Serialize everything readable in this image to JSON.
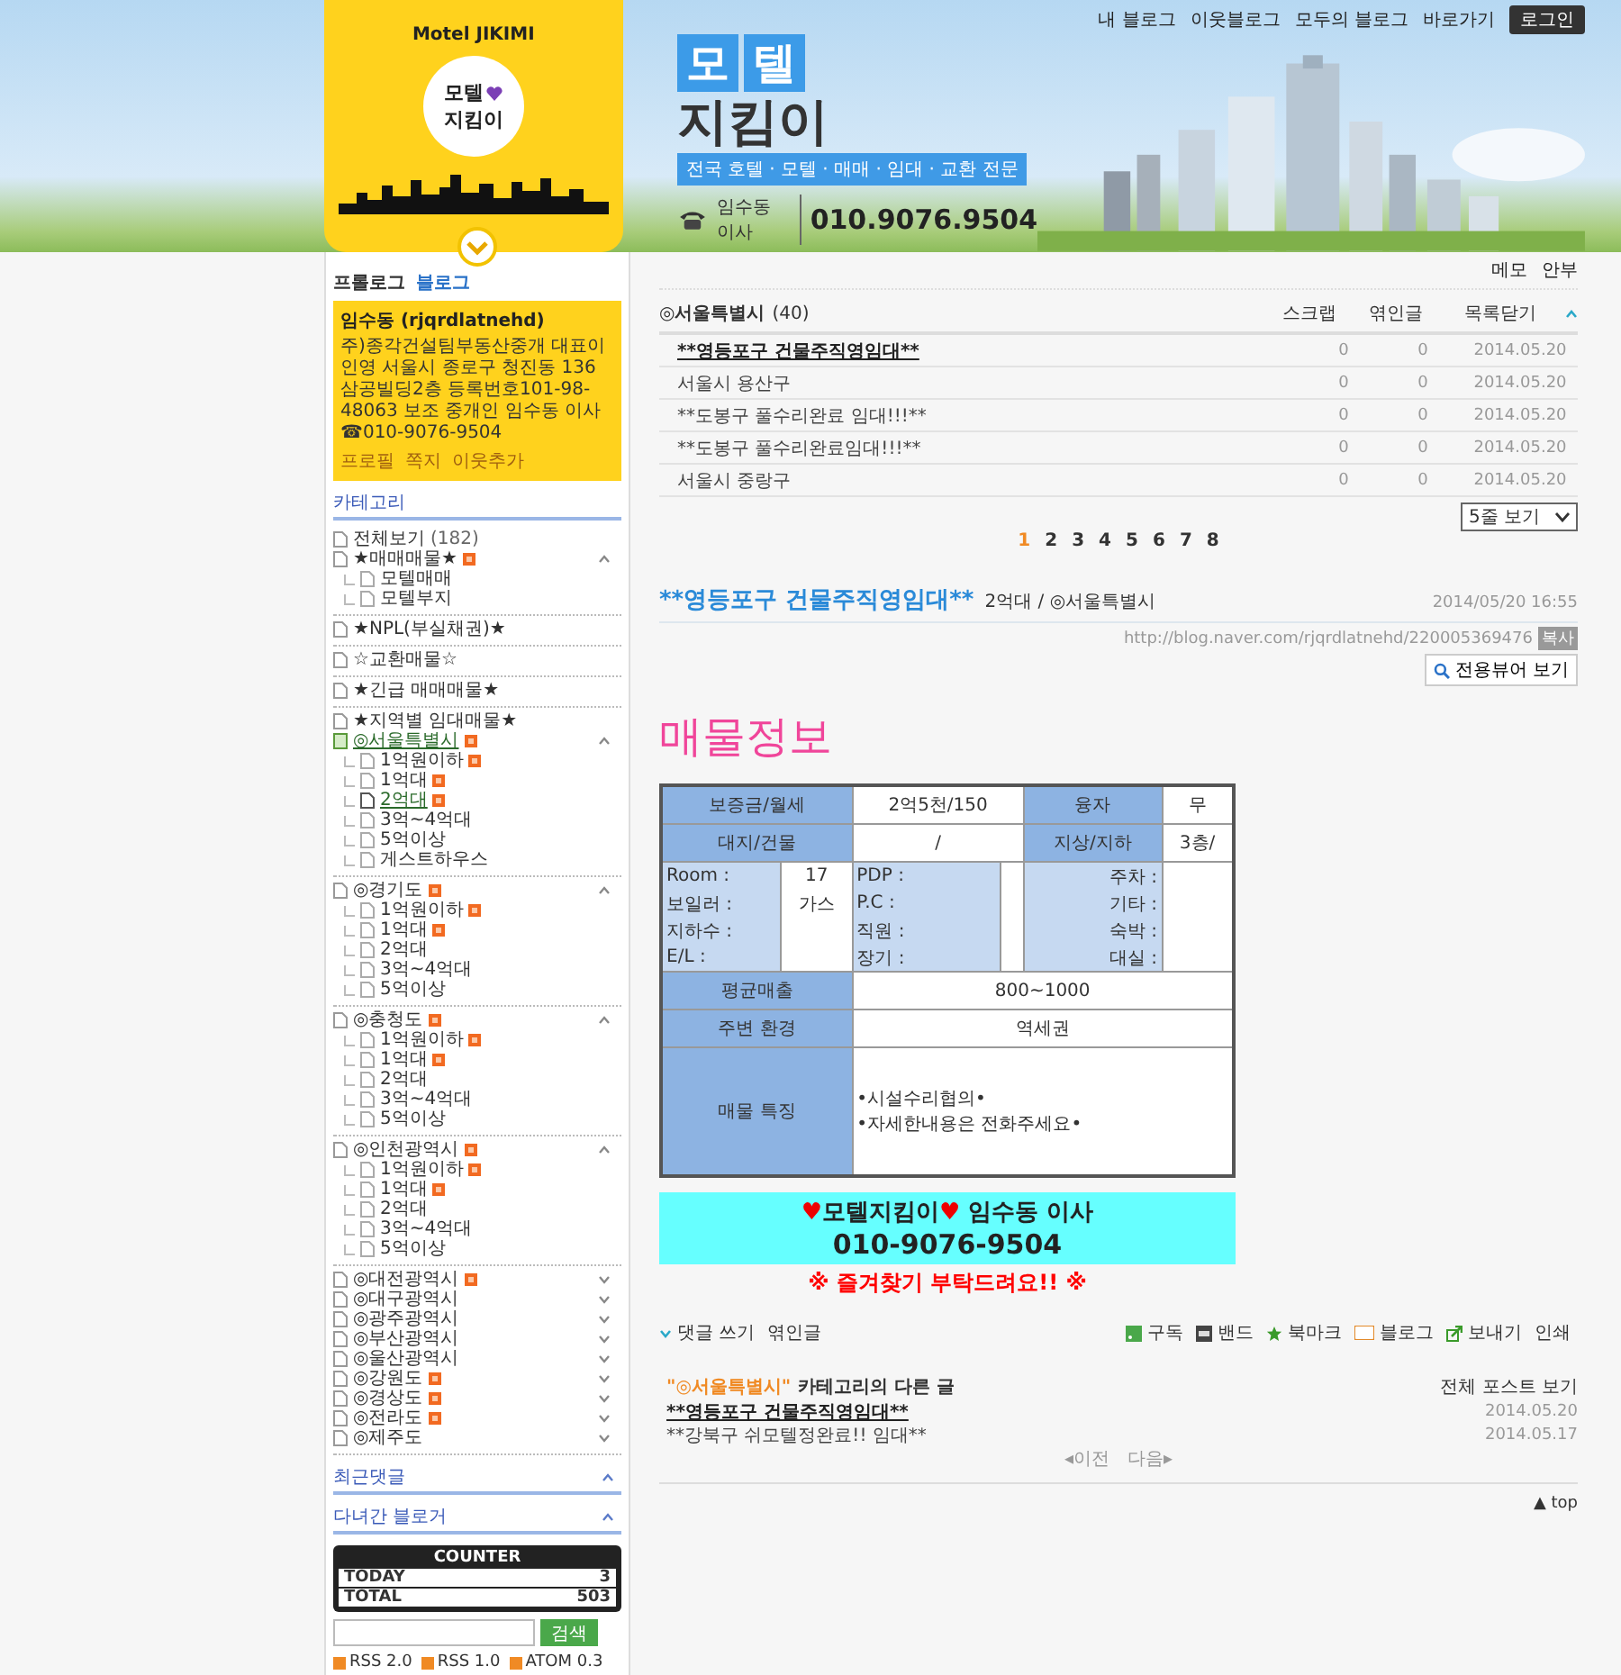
{
  "header": {
    "brand": "Motel JIKIMI",
    "badge_top": "모텔",
    "badge_bottom": "지킴이",
    "title_tiles": [
      "모",
      "텔"
    ],
    "title_bottom": "지킴이",
    "slogan": "전국 호텔 · 모텔 · 매매 · 임대 · 교환 전문",
    "contact_name": "임수동 이사",
    "phone": "010.9076.9504"
  },
  "top_nav": {
    "links": [
      "내 블로그",
      "이웃블로그",
      "모두의 블로그",
      "바로가기"
    ],
    "login": "로그인"
  },
  "sidebar": {
    "tabs": [
      {
        "label": "프롤로그",
        "selected": false
      },
      {
        "label": "블로그",
        "selected": true
      }
    ],
    "profile": {
      "name": "임수동 (rjqrdlatnehd)",
      "description": "주)종각건설팀부동산중개 대표이인영 서울시 종로구 청진동 136 삼공빌딩2층 등록번호101-98-48063 보조 중개인 임수동 이사☎010-9076-9504",
      "links": [
        "프로필",
        "쪽지",
        "이웃추가"
      ]
    },
    "category_title": "카테고리",
    "category_sections": [
      [
        {
          "label": "전체보기",
          "count": "(182)",
          "new": false,
          "selected": false
        },
        {
          "label": "★매매매물★",
          "new": true,
          "selected": false,
          "expanded": true,
          "children": [
            {
              "label": "모텔매매",
              "new": false,
              "selected": false
            },
            {
              "label": "모텔부지",
              "new": false,
              "selected": false
            }
          ]
        }
      ],
      [
        {
          "label": "★NPL(부실채권)★",
          "new": false,
          "selected": false
        }
      ],
      [
        {
          "label": "☆교환매물☆",
          "new": false,
          "selected": false
        }
      ],
      [
        {
          "label": "★긴급 매매매물★",
          "new": false,
          "selected": false
        }
      ],
      [
        {
          "label": "★지역별 임대매물★",
          "new": false,
          "selected": false
        },
        {
          "label": "◎서울특별시",
          "new": true,
          "selected": true,
          "expanded": true,
          "children": [
            {
              "label": "1억원이하",
              "new": true,
              "selected": false
            },
            {
              "label": "1억대",
              "new": true,
              "selected": false
            },
            {
              "label": "2억대",
              "new": true,
              "selected": true
            },
            {
              "label": "3억~4억대",
              "new": false,
              "selected": false
            },
            {
              "label": "5억이상",
              "new": false,
              "selected": false
            },
            {
              "label": "게스트하우스",
              "new": false,
              "selected": false
            }
          ]
        }
      ],
      [
        {
          "label": "◎경기도",
          "new": true,
          "selected": false,
          "expanded": true,
          "children": [
            {
              "label": "1억원이하",
              "new": true,
              "selected": false
            },
            {
              "label": "1억대",
              "new": true,
              "selected": false
            },
            {
              "label": "2억대",
              "new": false,
              "selected": false
            },
            {
              "label": "3억~4억대",
              "new": false,
              "selected": false
            },
            {
              "label": "5억이상",
              "new": false,
              "selected": false
            }
          ]
        }
      ],
      [
        {
          "label": "◎충청도",
          "new": true,
          "selected": false,
          "expanded": true,
          "children": [
            {
              "label": "1억원이하",
              "new": true,
              "selected": false
            },
            {
              "label": "1억대",
              "new": true,
              "selected": false
            },
            {
              "label": "2억대",
              "new": false,
              "selected": false
            },
            {
              "label": "3억~4억대",
              "new": false,
              "selected": false
            },
            {
              "label": "5억이상",
              "new": false,
              "selected": false
            }
          ]
        }
      ],
      [
        {
          "label": "◎인천광역시",
          "new": true,
          "selected": false,
          "expanded": true,
          "children": [
            {
              "label": "1억원이하",
              "new": true,
              "selected": false
            },
            {
              "label": "1억대",
              "new": true,
              "selected": false
            },
            {
              "label": "2억대",
              "new": false,
              "selected": false
            },
            {
              "label": "3억~4억대",
              "new": false,
              "selected": false
            },
            {
              "label": "5억이상",
              "new": false,
              "selected": false
            }
          ]
        }
      ],
      [
        {
          "label": "◎대전광역시",
          "new": true,
          "selected": false,
          "expanded": false
        },
        {
          "label": "◎대구광역시",
          "new": false,
          "selected": false,
          "expanded": false
        },
        {
          "label": "◎광주광역시",
          "new": false,
          "selected": false,
          "expanded": false
        },
        {
          "label": "◎부산광역시",
          "new": false,
          "selected": false,
          "expanded": false
        },
        {
          "label": "◎울산광역시",
          "new": false,
          "selected": false,
          "expanded": false
        },
        {
          "label": "◎강원도",
          "new": true,
          "selected": false,
          "expanded": false
        },
        {
          "label": "◎경상도",
          "new": true,
          "selected": false,
          "expanded": false
        },
        {
          "label": "◎전라도",
          "new": true,
          "selected": false,
          "expanded": false
        },
        {
          "label": "◎제주도",
          "new": false,
          "selected": false,
          "expanded": false
        }
      ]
    ],
    "panels": [
      {
        "label": "최근댓글",
        "expanded": false
      },
      {
        "label": "다녀간 블로거",
        "expanded": false
      }
    ],
    "counter": {
      "title": "COUNTER",
      "rows": [
        {
          "label": "TODAY",
          "value": "3"
        },
        {
          "label": "TOTAL",
          "value": "503"
        }
      ]
    },
    "search_button": "검색",
    "feeds": [
      "RSS 2.0",
      "RSS 1.0",
      "ATOM 0.3"
    ]
  },
  "main": {
    "top_links": [
      "메모",
      "안부"
    ],
    "post_list": {
      "category": "◎서울특별시",
      "count": "(40)",
      "columns": [
        "스크랩",
        "엮인글",
        "목록닫기"
      ],
      "rows": [
        {
          "title": "**영등포구 건물주직영임대**",
          "scrap": "0",
          "trackback": "0",
          "date": "2014.05.20",
          "selected": true
        },
        {
          "title": "서울시 용산구",
          "scrap": "0",
          "trackback": "0",
          "date": "2014.05.20",
          "selected": false
        },
        {
          "title": "**도봉구 풀수리완료 임대!!!**",
          "scrap": "0",
          "trackback": "0",
          "date": "2014.05.20",
          "selected": false
        },
        {
          "title": "**도봉구 풀수리완료임대!!!**",
          "scrap": "0",
          "trackback": "0",
          "date": "2014.05.20",
          "selected": false
        },
        {
          "title": "서울시 중랑구",
          "scrap": "0",
          "trackback": "0",
          "date": "2014.05.20",
          "selected": false
        }
      ],
      "page_size": "5줄 보기",
      "pages": [
        {
          "label": "1",
          "selected": true
        },
        {
          "label": "2",
          "selected": false
        },
        {
          "label": "3",
          "selected": false
        },
        {
          "label": "4",
          "selected": false
        },
        {
          "label": "5",
          "selected": false
        },
        {
          "label": "6",
          "selected": false
        },
        {
          "label": "7",
          "selected": false
        },
        {
          "label": "8",
          "selected": false
        }
      ]
    },
    "post": {
      "title": "**영등포구 건물주직영임대**",
      "category": "2억대 / ◎서울특별시",
      "date": "2014/05/20 16:55",
      "url": "http://blog.naver.com/rjqrdlatnehd/220005369476",
      "copy": "복사",
      "viewer_button": "전용뷰어 보기",
      "heading": "매물정보",
      "table": {
        "top_rows": [
          {
            "label": "보증금/월세",
            "value": "2억5천/150",
            "label2": "융자",
            "value2": "무"
          },
          {
            "label": "대지/건물",
            "value": "/",
            "label2": "지상/지하",
            "value2": "3층/"
          }
        ],
        "grid": [
          [
            {
              "label": "Room :",
              "value": "17"
            },
            {
              "label": "PDP :"
            },
            {
              "label": "주차 :"
            }
          ],
          [
            {
              "label": "보일러 :",
              "value": "가스"
            },
            {
              "label": "P.C :"
            },
            {
              "label": "기타 :"
            }
          ],
          [
            {
              "label": "지하수 :"
            },
            {
              "label": "직원 :"
            },
            {
              "label": "숙박 :"
            }
          ],
          [
            {
              "label": "E/L :"
            },
            {
              "label": "장기 :"
            },
            {
              "label": "대실 :"
            }
          ]
        ],
        "bottom_rows": [
          {
            "label": "평균매출",
            "lines": [
              "800~1000"
            ]
          },
          {
            "label": "주변 환경",
            "lines": [
              "역세권"
            ]
          },
          {
            "label": "매물 특징",
            "lines": [
              "•시설수리협의•",
              "•자세한내용은 전화주세요•"
            ]
          }
        ]
      },
      "banner": {
        "line1": [
          {
            "kind": "heart",
            "text": "♥"
          },
          {
            "kind": "text",
            "text": "모텔지킴이"
          },
          {
            "kind": "heart",
            "text": "♥"
          },
          {
            "kind": "text",
            "text": " 임수동 이사"
          }
        ],
        "line2": "010-9076-9504",
        "note": "※ 즐겨찾기 부탁드려요!! ※"
      },
      "comment_links": [
        "댓글 쓰기",
        "엮인글"
      ],
      "actions": [
        {
          "kind": "subscribe",
          "label": "구독"
        },
        {
          "kind": "band",
          "label": "밴드"
        },
        {
          "kind": "bookmark",
          "label": "북마크"
        },
        {
          "kind": "blog",
          "label": "블로그"
        },
        {
          "kind": "send",
          "label": "보내기"
        },
        {
          "kind": "print",
          "label": "인쇄"
        }
      ]
    },
    "other_posts": {
      "category": "\"◎서울특별시\"",
      "suffix": "카테고리의 다른 글",
      "all_link": "전체 포스트 보기",
      "rows": [
        {
          "title": "**영등포구 건물주직영임대**",
          "date": "2014.05.20",
          "selected": true
        },
        {
          "title": "**강북구 쉬모텔정완료!! 임대**",
          "date": "2014.05.17",
          "selected": false
        }
      ],
      "prev": "◂이전",
      "next": "다음▸"
    },
    "top_link": "▲ top"
  }
}
